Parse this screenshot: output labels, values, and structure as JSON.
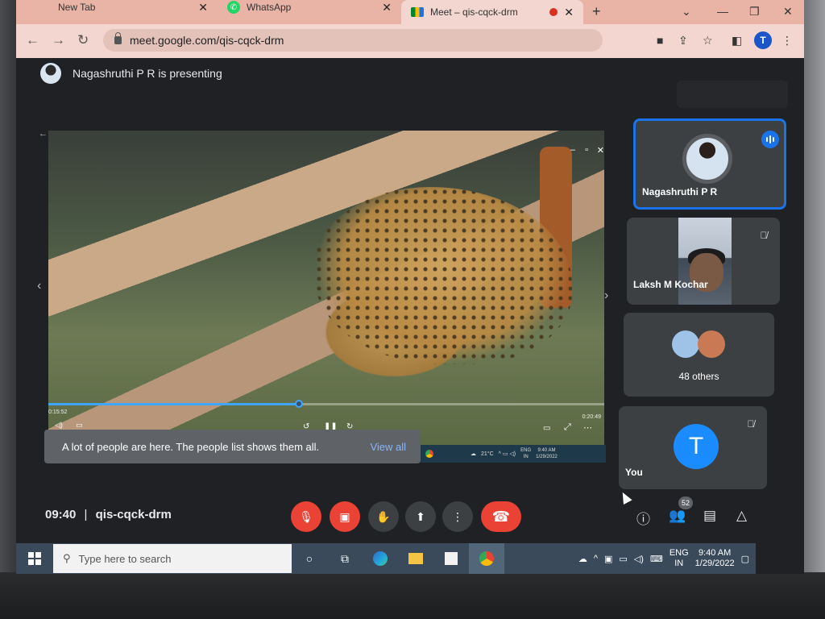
{
  "browser": {
    "tabs": [
      {
        "label": "New Tab"
      },
      {
        "label": "WhatsApp"
      },
      {
        "label": "Meet – qis-cqck-drm"
      }
    ],
    "url": "meet.google.com/qis-cqck-drm",
    "profile_initial": "T"
  },
  "meet": {
    "presenting_text": "Nagashruthi P R is presenting",
    "video": {
      "elapsed": "0:15:52",
      "remaining": "0:20:49",
      "progress_fraction": 0.45
    },
    "inner_taskbar": {
      "temperature": "21°C",
      "lang": "ENG",
      "region": "IN",
      "time": "9:40 AM",
      "date": "1/29/2022"
    },
    "toast": {
      "text": "A lot of people are here. The people list shows them all.",
      "link": "View all"
    },
    "tiles": [
      {
        "name": "Nagashruthi P R"
      },
      {
        "name": "Laksh M Kochar"
      },
      {
        "name": "48 others"
      },
      {
        "name": "You",
        "initial": "T"
      }
    ],
    "bottom": {
      "time": "09:40",
      "separator": "|",
      "code": "qis-cqck-drm",
      "people_count": "52"
    }
  },
  "taskbar": {
    "search_placeholder": "Type here to search",
    "lang": "ENG",
    "region": "IN",
    "time": "9:40 AM",
    "date": "1/29/2022"
  },
  "colors": {
    "meet_bg": "#202124",
    "accent_blue": "#1a73e8",
    "danger_red": "#ea4335",
    "chrome_tab_bg": "#f3d6cf"
  }
}
